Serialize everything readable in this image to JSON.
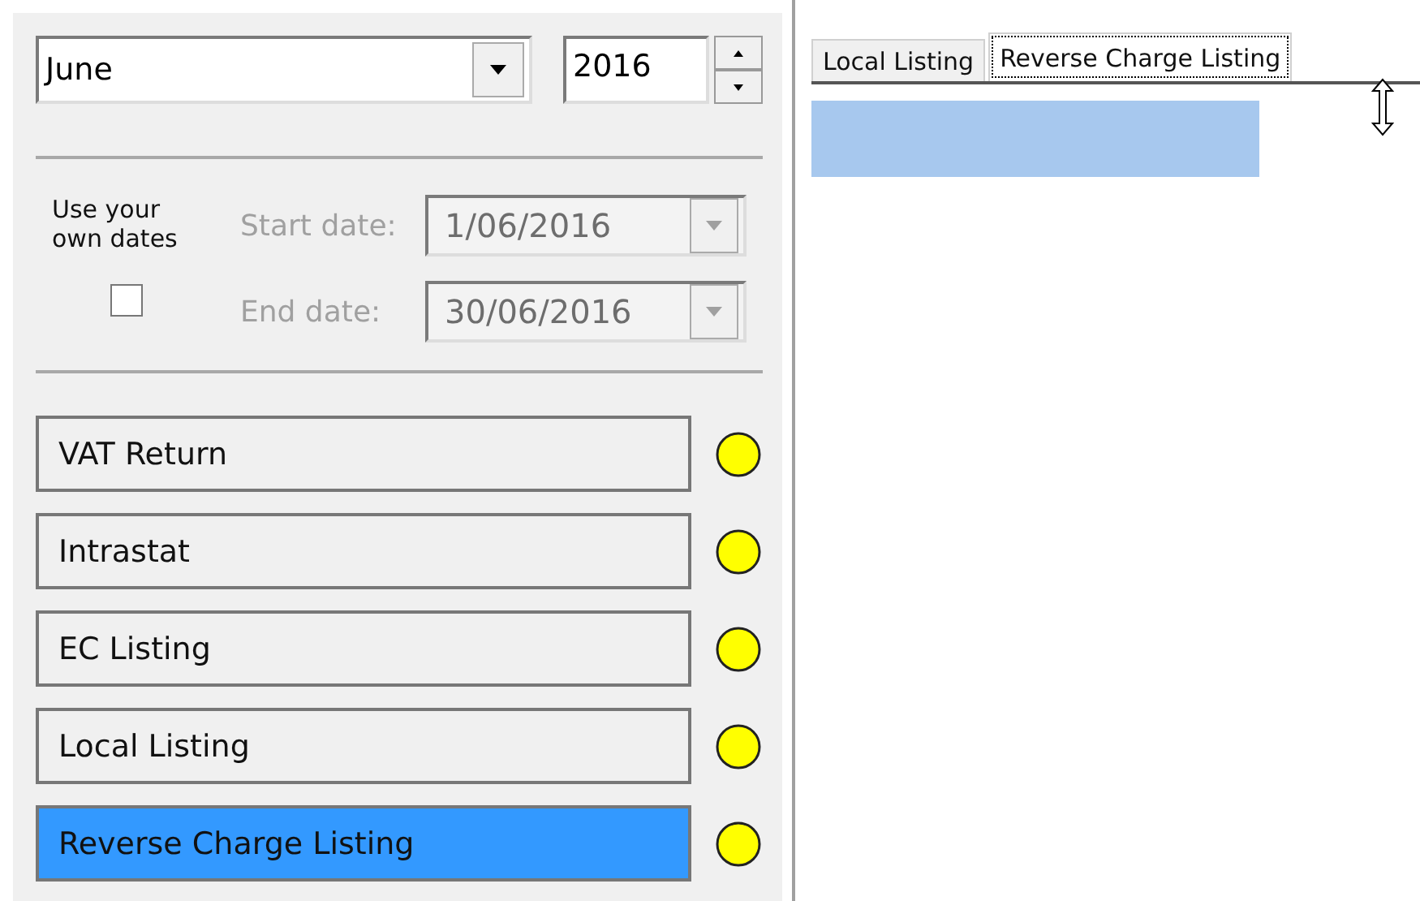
{
  "period": {
    "month": "June",
    "year": "2016"
  },
  "own_dates": {
    "label": "Use your own dates",
    "checked": false
  },
  "date_fields": [
    {
      "label": "Start date:",
      "value": "1/06/2016",
      "disabled": true
    },
    {
      "label": "End date:",
      "value": "30/06/2016",
      "disabled": true
    }
  ],
  "reports": [
    {
      "label": "VAT Return",
      "selected": false,
      "color": "#ffff00"
    },
    {
      "label": "Intrastat",
      "selected": false,
      "color": "#ffff00"
    },
    {
      "label": "EC Listing",
      "selected": false,
      "color": "#ffff00"
    },
    {
      "label": "Local Listing",
      "selected": false,
      "color": "#ffff00"
    },
    {
      "label": "Reverse Charge Listing",
      "selected": true,
      "color": "#ffff00"
    }
  ],
  "tabs": [
    {
      "label": "Local Listing",
      "selected": false
    },
    {
      "label": "Reverse Charge Listing",
      "selected": true
    }
  ]
}
